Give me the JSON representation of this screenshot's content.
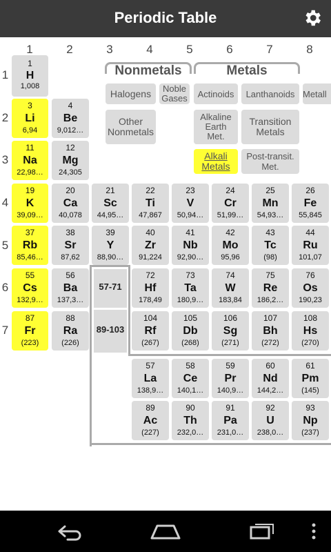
{
  "app": {
    "title": "Periodic Table",
    "settings_icon": "gear-icon"
  },
  "groups": [
    "1",
    "2",
    "3",
    "4",
    "5",
    "6",
    "7",
    "8"
  ],
  "periods": [
    "1",
    "2",
    "3",
    "4",
    "5",
    "6",
    "7"
  ],
  "legend": {
    "nonmetals_header": "Nonmetals",
    "metals_header": "Metals",
    "categories": {
      "halogens": "Halogens",
      "noble": "Noble\nGases",
      "actinoids": "Actinoids",
      "lanthanoids": "Lanthanoids",
      "metalloids": "Metall",
      "other_nonmetals": "Other\nNonmetals",
      "alkaline": "Alkaline\nEarth\nMet.",
      "transition": "Transition\nMetals",
      "alkali": "Alkali\nMetals",
      "post": "Post-transit.\nMet."
    },
    "selected": "alkali"
  },
  "elements": {
    "H": {
      "num": "1",
      "sym": "H",
      "mass": "1,008"
    },
    "Li": {
      "num": "3",
      "sym": "Li",
      "mass": "6,94"
    },
    "Be": {
      "num": "4",
      "sym": "Be",
      "mass": "9,012…"
    },
    "Na": {
      "num": "11",
      "sym": "Na",
      "mass": "22,98…"
    },
    "Mg": {
      "num": "12",
      "sym": "Mg",
      "mass": "24,305"
    },
    "K": {
      "num": "19",
      "sym": "K",
      "mass": "39,09…"
    },
    "Ca": {
      "num": "20",
      "sym": "Ca",
      "mass": "40,078"
    },
    "Sc": {
      "num": "21",
      "sym": "Sc",
      "mass": "44,95…"
    },
    "Ti": {
      "num": "22",
      "sym": "Ti",
      "mass": "47,867"
    },
    "V": {
      "num": "23",
      "sym": "V",
      "mass": "50,94…"
    },
    "Cr": {
      "num": "24",
      "sym": "Cr",
      "mass": "51,99…"
    },
    "Mn": {
      "num": "25",
      "sym": "Mn",
      "mass": "54,93…"
    },
    "Fe": {
      "num": "26",
      "sym": "Fe",
      "mass": "55,845"
    },
    "Rb": {
      "num": "37",
      "sym": "Rb",
      "mass": "85,46…"
    },
    "Sr": {
      "num": "38",
      "sym": "Sr",
      "mass": "87,62"
    },
    "Y": {
      "num": "39",
      "sym": "Y",
      "mass": "88,90…"
    },
    "Zr": {
      "num": "40",
      "sym": "Zr",
      "mass": "91,224"
    },
    "Nb": {
      "num": "41",
      "sym": "Nb",
      "mass": "92,90…"
    },
    "Mo": {
      "num": "42",
      "sym": "Mo",
      "mass": "95,96"
    },
    "Tc": {
      "num": "43",
      "sym": "Tc",
      "mass": "(98)"
    },
    "Ru": {
      "num": "44",
      "sym": "Ru",
      "mass": "101,07"
    },
    "Cs": {
      "num": "55",
      "sym": "Cs",
      "mass": "132,9…"
    },
    "Ba": {
      "num": "56",
      "sym": "Ba",
      "mass": "137,3…"
    },
    "Hf": {
      "num": "72",
      "sym": "Hf",
      "mass": "178,49"
    },
    "Ta": {
      "num": "73",
      "sym": "Ta",
      "mass": "180,9…"
    },
    "W": {
      "num": "74",
      "sym": "W",
      "mass": "183,84"
    },
    "Re": {
      "num": "75",
      "sym": "Re",
      "mass": "186,2…"
    },
    "Os": {
      "num": "76",
      "sym": "Os",
      "mass": "190,23"
    },
    "Fr": {
      "num": "87",
      "sym": "Fr",
      "mass": "(223)"
    },
    "Ra": {
      "num": "88",
      "sym": "Ra",
      "mass": "(226)"
    },
    "Rf": {
      "num": "104",
      "sym": "Rf",
      "mass": "(267)"
    },
    "Db": {
      "num": "105",
      "sym": "Db",
      "mass": "(268)"
    },
    "Sg": {
      "num": "106",
      "sym": "Sg",
      "mass": "(271)"
    },
    "Bh": {
      "num": "107",
      "sym": "Bh",
      "mass": "(272)"
    },
    "Hs": {
      "num": "108",
      "sym": "Hs",
      "mass": "(270)"
    },
    "La": {
      "num": "57",
      "sym": "La",
      "mass": "138,9…"
    },
    "Ce": {
      "num": "58",
      "sym": "Ce",
      "mass": "140,1…"
    },
    "Pr": {
      "num": "59",
      "sym": "Pr",
      "mass": "140,9…"
    },
    "Nd": {
      "num": "60",
      "sym": "Nd",
      "mass": "144,2…"
    },
    "Pm": {
      "num": "61",
      "sym": "Pm",
      "mass": "(145)"
    },
    "Ac": {
      "num": "89",
      "sym": "Ac",
      "mass": "(227)"
    },
    "Th": {
      "num": "90",
      "sym": "Th",
      "mass": "232,0…"
    },
    "Pa": {
      "num": "91",
      "sym": "Pa",
      "mass": "231,0…"
    },
    "U": {
      "num": "92",
      "sym": "U",
      "mass": "238,0…"
    },
    "Np": {
      "num": "93",
      "sym": "Np",
      "mass": "(237)"
    }
  },
  "lanthanide_range": "57-71",
  "actinide_range": "89-103",
  "colors": {
    "alkali": "#ffff33",
    "cell": "#dcdcdc",
    "appbar": "#3a3a3a"
  },
  "navbar": {
    "back_icon": "back-icon",
    "home_icon": "home-icon",
    "recents_icon": "recents-icon",
    "menu_icon": "overflow-menu-icon"
  }
}
